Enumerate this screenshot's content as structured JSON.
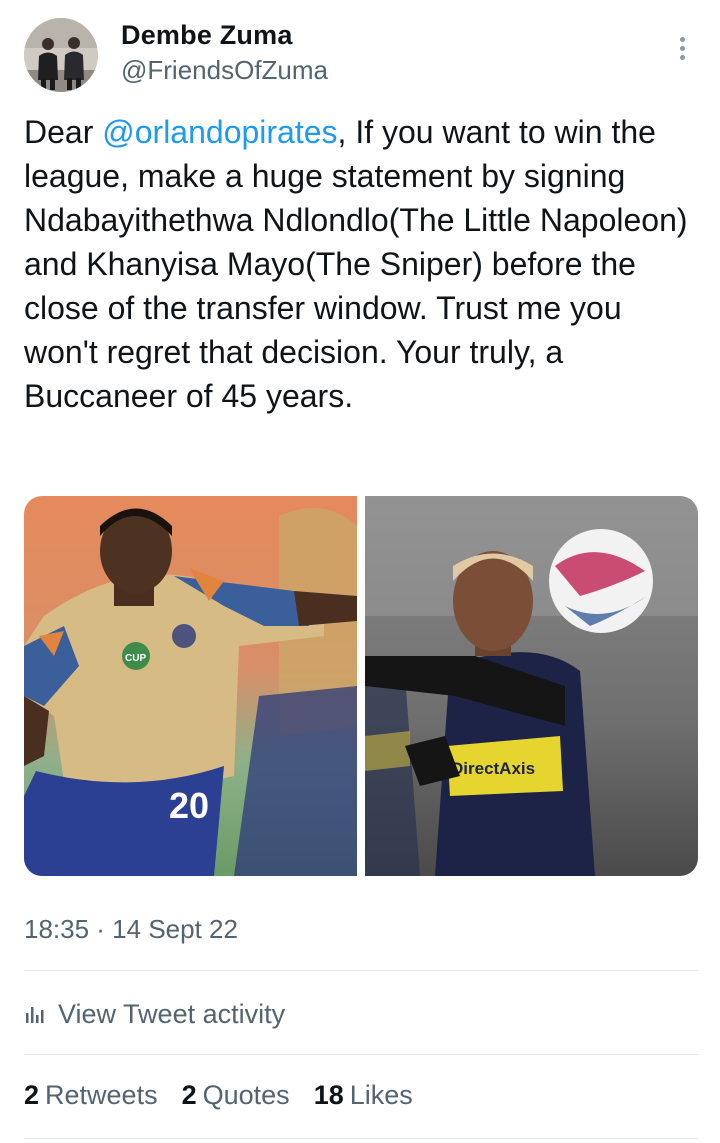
{
  "author": {
    "name": "Dembe Zuma",
    "handle": "@FriendsOfZuma",
    "avatar_icon": "profile-photo-two-men"
  },
  "tweet": {
    "greeting": "Dear ",
    "mention": "@orlandopirates",
    "body": ", If you want to win the league, make a huge statement by signing Ndabayithethwa Ndlondlo(The Little Napoleon) and Khanyisa Mayo(The Sniper) before the close of the transfer window. Trust me you won't regret that decision. Your truly, a Buccaneer of 45 years."
  },
  "media": {
    "photos": [
      {
        "icon": "footballer-photo-gold-kit",
        "jersey_number": "20",
        "badge_text": "CUP"
      },
      {
        "icon": "footballer-photo-navy-kit",
        "sponsor_text": "DirectAxis"
      }
    ]
  },
  "meta": {
    "timestamp": "18:35 · 14 Sept 22"
  },
  "activity": {
    "label": "View Tweet activity",
    "icon": "bar-chart-icon"
  },
  "stats": {
    "retweets_count": "2",
    "retweets_label": "Retweets",
    "quotes_count": "2",
    "quotes_label": "Quotes",
    "likes_count": "18",
    "likes_label": "Likes"
  },
  "colors": {
    "link": "#1d9bf0",
    "secondary_text": "#536471",
    "primary_text": "#0f1419",
    "divider": "#e1e6ea"
  }
}
